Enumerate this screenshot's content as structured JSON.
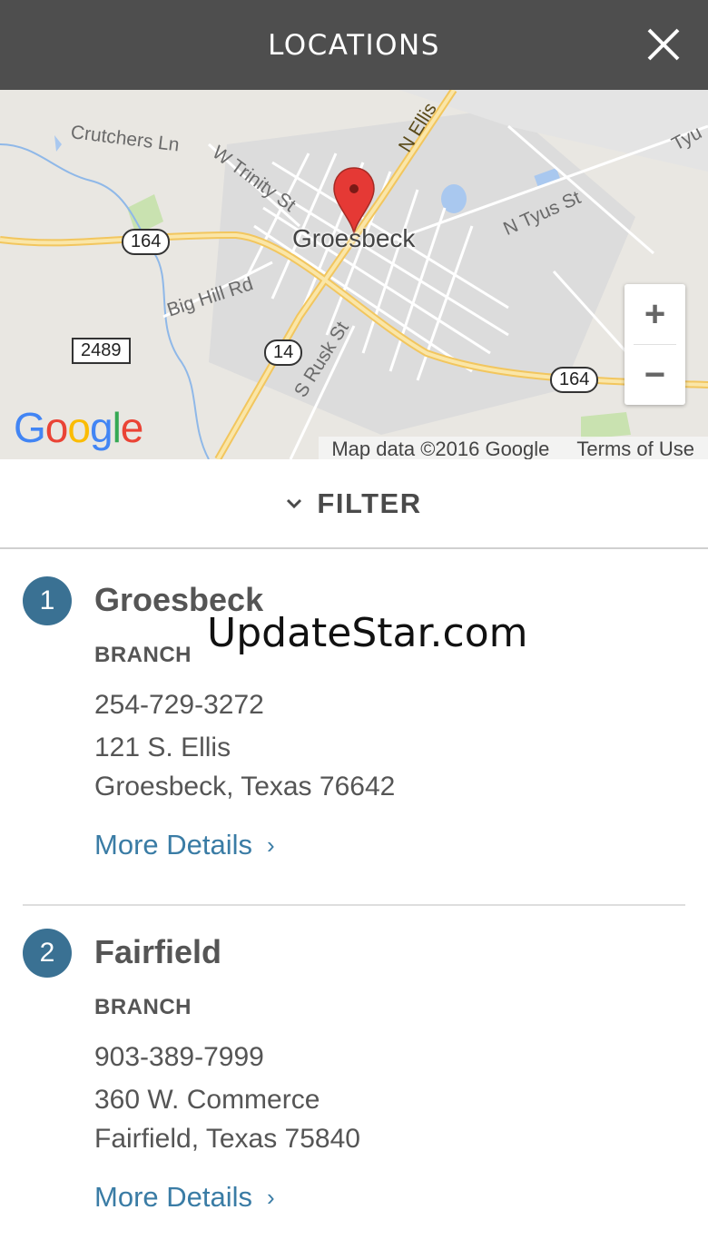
{
  "header": {
    "title": "LOCATIONS",
    "close_icon": "close-icon"
  },
  "map": {
    "roads": {
      "crutchers": "Crutchers Ln",
      "trinity": "W Trinity St",
      "ellis": "N Ellis",
      "tyus": "N Tyus St",
      "tyus_short": "Tyu",
      "big_hill": "Big Hill Rd",
      "rusk": "S Rusk St"
    },
    "town": "Groesbeck",
    "shields": {
      "hwy164a": "164",
      "hwy164b": "164",
      "hwy14": "14",
      "fm2489": "2489"
    },
    "zoom_in": "+",
    "zoom_out": "−",
    "logo": "Google",
    "attribution": {
      "map_data": "Map data ©2016 Google",
      "terms": "Terms of Use"
    },
    "colors": {
      "pin": "#e53935",
      "road_major": "#f7d98b",
      "water": "#a9c8ef"
    }
  },
  "filter": {
    "label": "FILTER",
    "icon": "chevron-down-icon"
  },
  "locations": [
    {
      "number": "1",
      "name": "Groesbeck",
      "type": "BRANCH",
      "phone": "254-729-3272",
      "street": "121 S. Ellis",
      "city": "Groesbeck, Texas 76642",
      "link": "More Details"
    },
    {
      "number": "2",
      "name": "Fairfield",
      "type": "BRANCH",
      "phone": "903-389-7999",
      "street": "360 W. Commerce",
      "city": "Fairfield, Texas 75840",
      "link": "More Details"
    }
  ],
  "watermark": "UpdateStar.com",
  "accent_color": "#3a7193"
}
